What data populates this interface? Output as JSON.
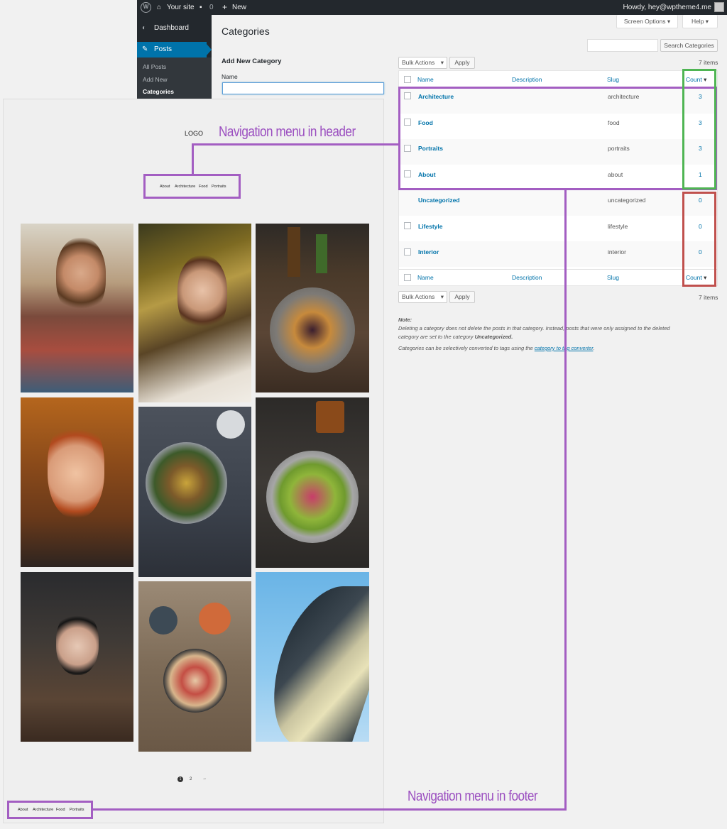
{
  "admin_bar": {
    "site_name": "Your site",
    "comments_count": "0",
    "new_label": "New",
    "howdy": "Howdy, hey@wptheme4.me"
  },
  "sidebar": {
    "dashboard": "Dashboard",
    "posts": "Posts",
    "submenu": [
      "All Posts",
      "Add New",
      "Categories"
    ]
  },
  "page": {
    "title": "Categories",
    "screen_options": "Screen Options",
    "help": "Help"
  },
  "add_new": {
    "title": "Add New Category",
    "name_label": "Name",
    "name_value": ""
  },
  "search": {
    "value": "",
    "button": "Search Categories"
  },
  "bulk": {
    "select_label": "Bulk Actions",
    "apply": "Apply",
    "items_count": "7 items"
  },
  "table": {
    "columns": [
      "Name",
      "Description",
      "Slug",
      "Count"
    ],
    "rows": [
      {
        "name": "Architecture",
        "slug": "architecture",
        "count": "3"
      },
      {
        "name": "Food",
        "slug": "food",
        "count": "3"
      },
      {
        "name": "Portraits",
        "slug": "portraits",
        "count": "3"
      },
      {
        "name": "About",
        "slug": "about",
        "count": "1"
      },
      {
        "name": "Uncategorized",
        "slug": "uncategorized",
        "count": "0"
      },
      {
        "name": "Lifestyle",
        "slug": "lifestyle",
        "count": "0"
      },
      {
        "name": "Interior",
        "slug": "interior",
        "count": "0"
      }
    ]
  },
  "note": {
    "title": "Note:",
    "line1": "Deleting a category does not delete the posts in that category. Instead, posts that were only assigned to the deleted",
    "line2_prefix": "category are set to the category ",
    "line2_bold": "Uncategorized.",
    "line3_prefix": "Categories can be selectively converted to tags using the ",
    "line3_link": "category to tag converter",
    "line3_suffix": "."
  },
  "preview": {
    "logo": "LOGO",
    "header_menu": [
      "About",
      "Architecture",
      "Food",
      "Portraits"
    ],
    "footer_menu": [
      "About",
      "Architecture",
      "Food",
      "Portraits"
    ],
    "pager": [
      "1",
      "2",
      "→"
    ]
  },
  "annotations": {
    "header_label": "Navigation menu in header",
    "footer_label": "Navigation menu in footer",
    "purple": "#a35ec2",
    "green": "#4fb553",
    "red": "#c0504d"
  },
  "colors": {
    "admin_dark": "#23282d",
    "accent_blue": "#0073aa",
    "background": "#f1f1f1"
  }
}
